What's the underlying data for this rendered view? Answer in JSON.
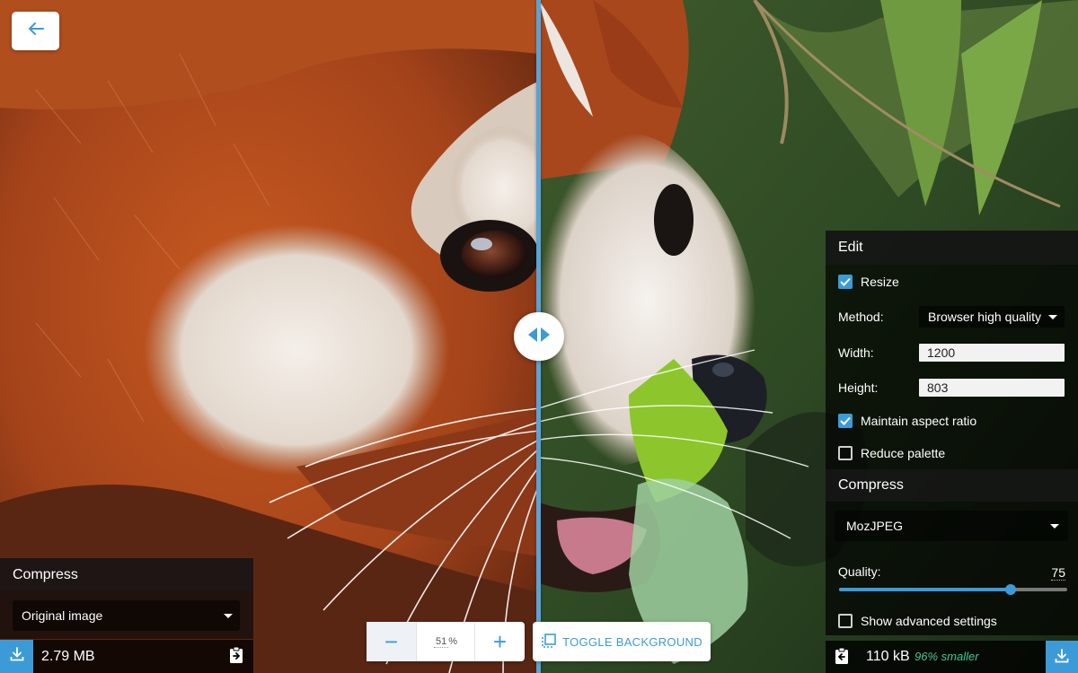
{
  "zoom": {
    "value": "51",
    "unit": "%",
    "decrease_symbol": "−",
    "increase_symbol": "+"
  },
  "toolbar": {
    "toggle_background_label": "TOGGLE BACKGROUND"
  },
  "left_panel": {
    "title": "Compress",
    "selected_option": "Original image",
    "file_size": "2.79 MB"
  },
  "right_panel": {
    "edit_title": "Edit",
    "resize": {
      "label": "Resize",
      "checked": true
    },
    "method": {
      "label": "Method:",
      "value": "Browser high quality"
    },
    "width": {
      "label": "Width:",
      "value": "1200"
    },
    "height": {
      "label": "Height:",
      "value": "803"
    },
    "maintain_aspect": {
      "label": "Maintain aspect ratio",
      "checked": true
    },
    "reduce_palette": {
      "label": "Reduce palette",
      "checked": false
    },
    "compress_title": "Compress",
    "codec": "MozJPEG",
    "quality": {
      "label": "Quality:",
      "value": "75",
      "fraction": 0.75
    },
    "advanced": {
      "label": "Show advanced settings",
      "checked": false
    },
    "file_size": "110 kB",
    "savings": "96% smaller"
  },
  "colors": {
    "accent": "#3c9bd6",
    "savings": "#44c98e",
    "divider": "#5aa3d6"
  },
  "icons": [
    "arrow-left-icon",
    "split-handle-icon",
    "download-icon",
    "copy-icon",
    "toggle-background-icon",
    "checkmark-icon"
  ]
}
